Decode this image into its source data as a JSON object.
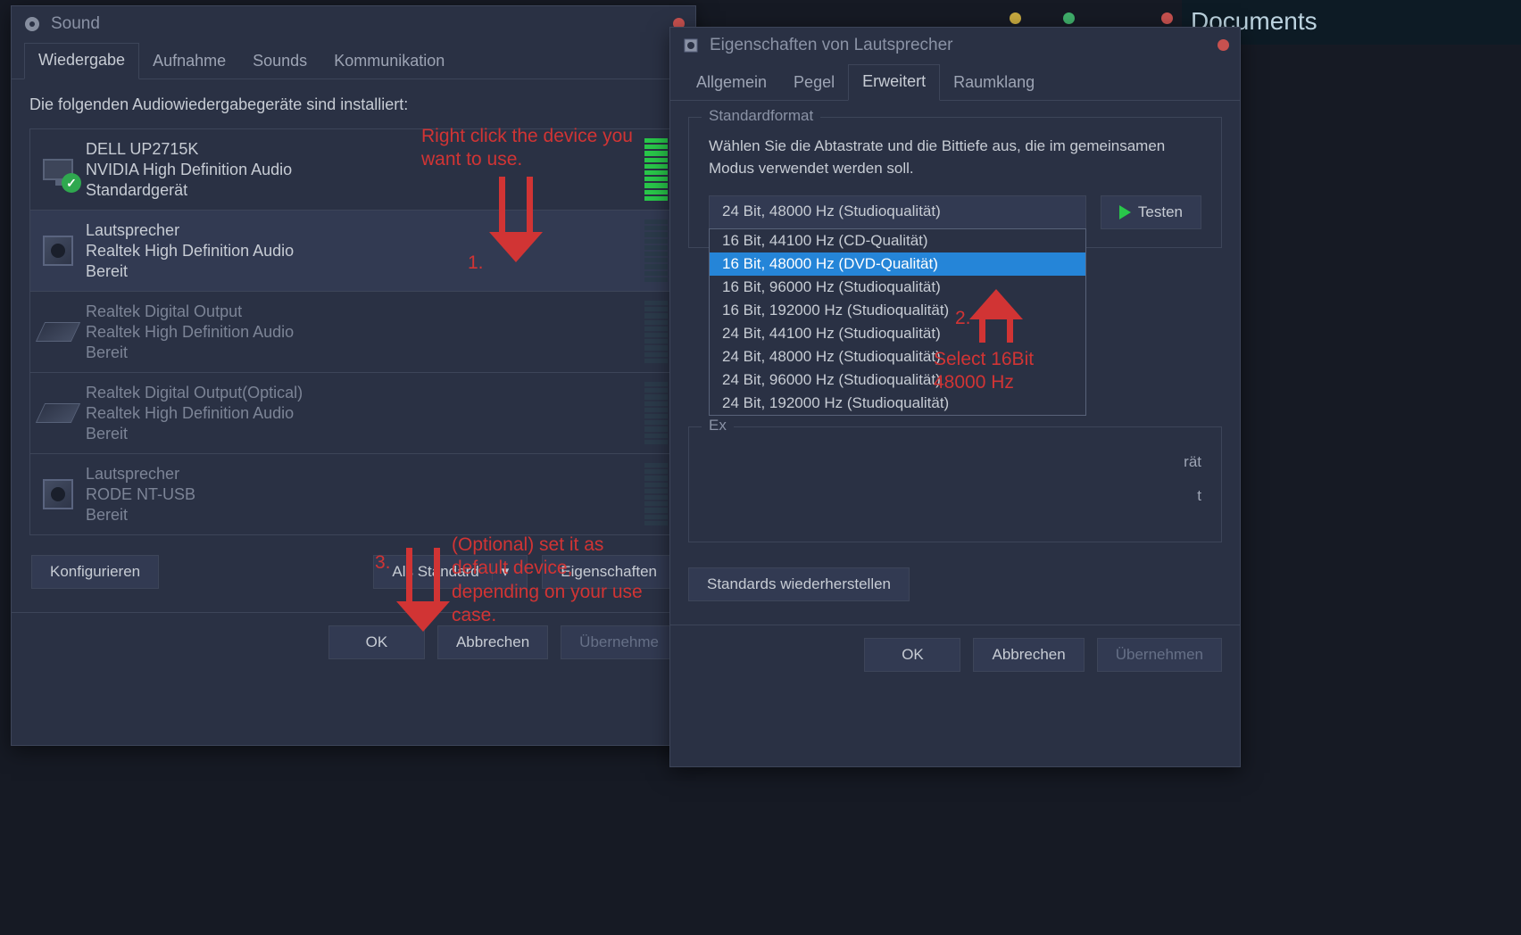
{
  "background": {
    "documents_label": "Documents"
  },
  "sound_window": {
    "title": "Sound",
    "tabs": [
      "Wiedergabe",
      "Aufnahme",
      "Sounds",
      "Kommunikation"
    ],
    "active_tab": 0,
    "description": "Die folgenden Audiowiedergabegeräte sind installiert:",
    "devices": [
      {
        "name": "DELL UP2715K",
        "driver": "NVIDIA High Definition Audio",
        "status": "Standardgerät",
        "icon": "monitor",
        "default": true,
        "vu_on": true
      },
      {
        "name": "Lautsprecher",
        "driver": "Realtek High Definition Audio",
        "status": "Bereit",
        "icon": "speaker",
        "default": false,
        "vu_on": false,
        "selected": true
      },
      {
        "name": "Realtek Digital Output",
        "driver": "Realtek High Definition Audio",
        "status": "Bereit",
        "icon": "hdmi",
        "default": false,
        "vu_on": false
      },
      {
        "name": "Realtek Digital Output(Optical)",
        "driver": "Realtek High Definition Audio",
        "status": "Bereit",
        "icon": "hdmi",
        "default": false,
        "vu_on": false
      },
      {
        "name": "Lautsprecher",
        "driver": "RODE NT-USB",
        "status": "Bereit",
        "icon": "speaker",
        "default": false,
        "vu_on": false
      }
    ],
    "buttons": {
      "configure": "Konfigurieren",
      "set_default": "Als Standard",
      "properties": "Eigenschaften",
      "ok": "OK",
      "cancel": "Abbrechen",
      "apply": "Übernehme"
    }
  },
  "props_window": {
    "title": "Eigenschaften von Lautsprecher",
    "tabs": [
      "Allgemein",
      "Pegel",
      "Erweitert",
      "Raumklang"
    ],
    "active_tab": 2,
    "standard_format": {
      "legend": "Standardformat",
      "desc": "Wählen Sie die Abtastrate und die Bittiefe aus, die im gemeinsamen Modus verwendet werden soll.",
      "current": "24 Bit, 48000 Hz (Studioqualität)",
      "options": [
        "16 Bit, 44100 Hz (CD-Qualität)",
        "16 Bit, 48000 Hz (DVD-Qualität)",
        "16 Bit, 96000 Hz (Studioqualität)",
        "16 Bit, 192000 Hz (Studioqualität)",
        "24 Bit, 44100 Hz (Studioqualität)",
        "24 Bit, 48000 Hz (Studioqualität)",
        "24 Bit, 96000 Hz (Studioqualität)",
        "24 Bit, 192000 Hz (Studioqualität)"
      ],
      "highlighted_index": 1,
      "test": "Testen"
    },
    "exclusive": {
      "legend": "Ex",
      "line1": "rät",
      "line2": "t"
    },
    "restore_defaults": "Standards wiederherstellen",
    "ok": "OK",
    "cancel": "Abbrechen",
    "apply": "Übernehmen"
  },
  "annotations": {
    "a1_text": "Right click the device you want to use.",
    "a1_num": "1.",
    "a2_num": "2.",
    "a2_text": "Select 16Bit 48000 Hz",
    "a3_num": "3.",
    "a3_text": "(Optional) set it as default device, depending on your use case."
  }
}
